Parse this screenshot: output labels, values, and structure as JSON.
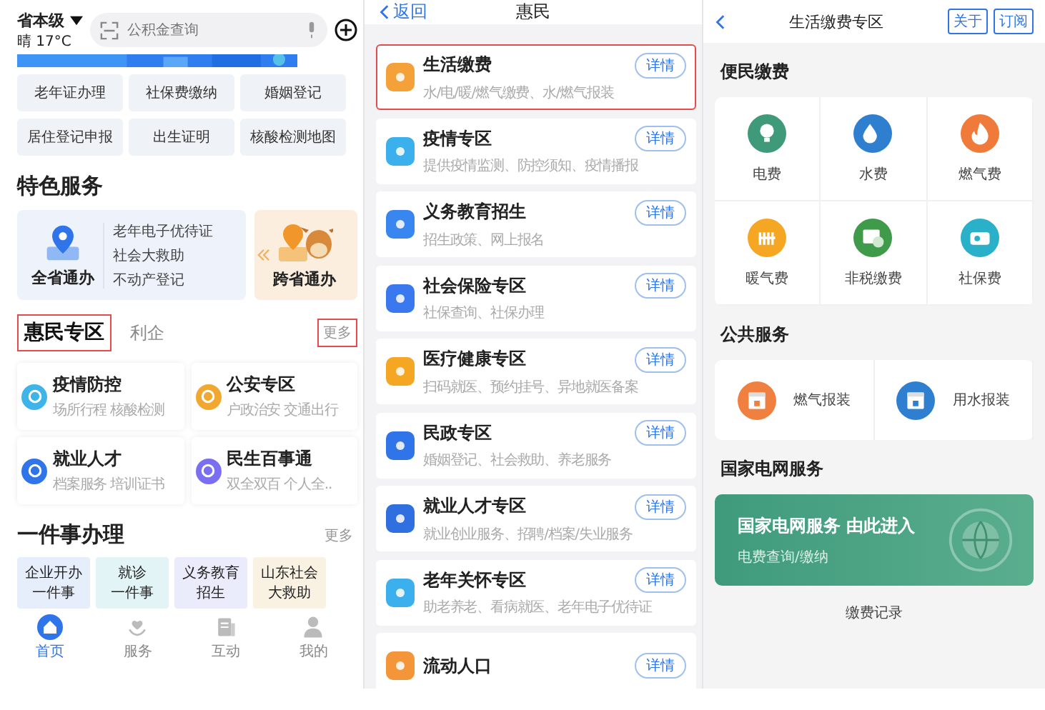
{
  "left": {
    "location": "省本级",
    "weather": "晴 17°C",
    "search": {
      "placeholder": "公积金查询"
    },
    "quick_links": [
      "老年证办理",
      "社保费缴纳",
      "婚姻登记",
      "居住登记申报",
      "出生证明",
      "核酸检测地图"
    ],
    "featured": {
      "title": "特色服务",
      "cards": [
        {
          "title": "全省通办",
          "items": [
            "老年电子优待证",
            "社会大救助",
            "不动产登记"
          ]
        },
        {
          "title": "跨省通办"
        }
      ]
    },
    "tabs": [
      {
        "label": "惠民专区",
        "selected": true,
        "highlighted": true
      },
      {
        "label": "利企",
        "selected": false,
        "highlighted": false
      }
    ],
    "more": {
      "label": "更多",
      "highlighted": true
    },
    "services": [
      {
        "title": "疫情防控",
        "subtitle": "场所行程  核酸检测",
        "color": "#3fb4e8"
      },
      {
        "title": "公安专区",
        "subtitle": "户政治安 交通出行",
        "color": "#f0a830"
      },
      {
        "title": "就业人才",
        "subtitle": "档案服务 培训证书",
        "color": "#2f74e8"
      },
      {
        "title": "民生百事通",
        "subtitle": "双全双百  个人全..",
        "color": "#7a6ff0"
      }
    ],
    "one_thing": {
      "title": "一件事办理",
      "more": "更多",
      "tiles": [
        {
          "lines": [
            "企业开办",
            "一件事"
          ],
          "color": "#e6eefb"
        },
        {
          "lines": [
            "就诊",
            "一件事"
          ],
          "color": "#e3f4f7"
        },
        {
          "lines": [
            "义务教育",
            "招生"
          ],
          "color": "#eaecfb"
        },
        {
          "lines": [
            "山东社会",
            "大救助"
          ],
          "color": "#f9f2e2"
        }
      ]
    },
    "nav": [
      {
        "label": "首页",
        "selected": true
      },
      {
        "label": "服务",
        "selected": false
      },
      {
        "label": "互动",
        "selected": false
      },
      {
        "label": "我的",
        "selected": false
      }
    ]
  },
  "middle": {
    "back": "返回",
    "title": "惠民",
    "items": [
      {
        "title": "生活缴费",
        "subtitle": "水/电/暖/燃气缴费、水/燃气报装",
        "color": "#f5a13a",
        "highlighted": true,
        "button": "详情"
      },
      {
        "title": "疫情专区",
        "subtitle": "提供疫情监测、防控须知、疫情播报",
        "color": "#3cb0ec",
        "highlighted": false,
        "button": "详情"
      },
      {
        "title": "义务教育招生",
        "subtitle": "招生政策、网上报名",
        "color": "#3a86f0",
        "highlighted": false,
        "button": "详情"
      },
      {
        "title": "社会保险专区",
        "subtitle": "社保查询、社保办理",
        "color": "#3a78f0",
        "highlighted": false,
        "button": "详情"
      },
      {
        "title": "医疗健康专区",
        "subtitle": "扫码就医、预约挂号、异地就医备案",
        "color": "#f5a623",
        "highlighted": false,
        "button": "详情"
      },
      {
        "title": "民政专区",
        "subtitle": "婚姻登记、社会救助、养老服务",
        "color": "#2f74e8",
        "highlighted": false,
        "button": "详情"
      },
      {
        "title": "就业人才专区",
        "subtitle": "就业创业服务、招聘/档案/失业服务",
        "color": "#2f6fe0",
        "highlighted": false,
        "button": "详情"
      },
      {
        "title": "老年关怀专区",
        "subtitle": "助老养老、看病就医、老年电子优待证",
        "color": "#3cb0ec",
        "highlighted": false,
        "button": "详情"
      },
      {
        "title": "流动人口",
        "color": "#f5953a",
        "highlighted": false,
        "button": "详情"
      }
    ]
  },
  "right": {
    "title": "生活缴费专区",
    "buttons": [
      "关于",
      "订阅"
    ],
    "payment": {
      "title": "便民缴费",
      "items": [
        {
          "label": "电费",
          "color": "#3e9a78"
        },
        {
          "label": "水费",
          "color": "#2f7fd0"
        },
        {
          "label": "燃气费",
          "color": "#f07a3a"
        },
        {
          "label": "暖气费",
          "color": "#f5a623"
        },
        {
          "label": "非税缴费",
          "color": "#3f9a4a"
        },
        {
          "label": "社保费",
          "color": "#2ab0c8"
        }
      ]
    },
    "public": {
      "title": "公共服务",
      "items": [
        {
          "label": "燃气报装",
          "color": "#f08040"
        },
        {
          "label": "用水报装",
          "color": "#2f7fd0"
        }
      ]
    },
    "grid": {
      "title": "国家电网服务",
      "banner_title": "国家电网服务 由此进入",
      "banner_subtitle": "电费查询/缴纳"
    },
    "records": "缴费记录"
  }
}
